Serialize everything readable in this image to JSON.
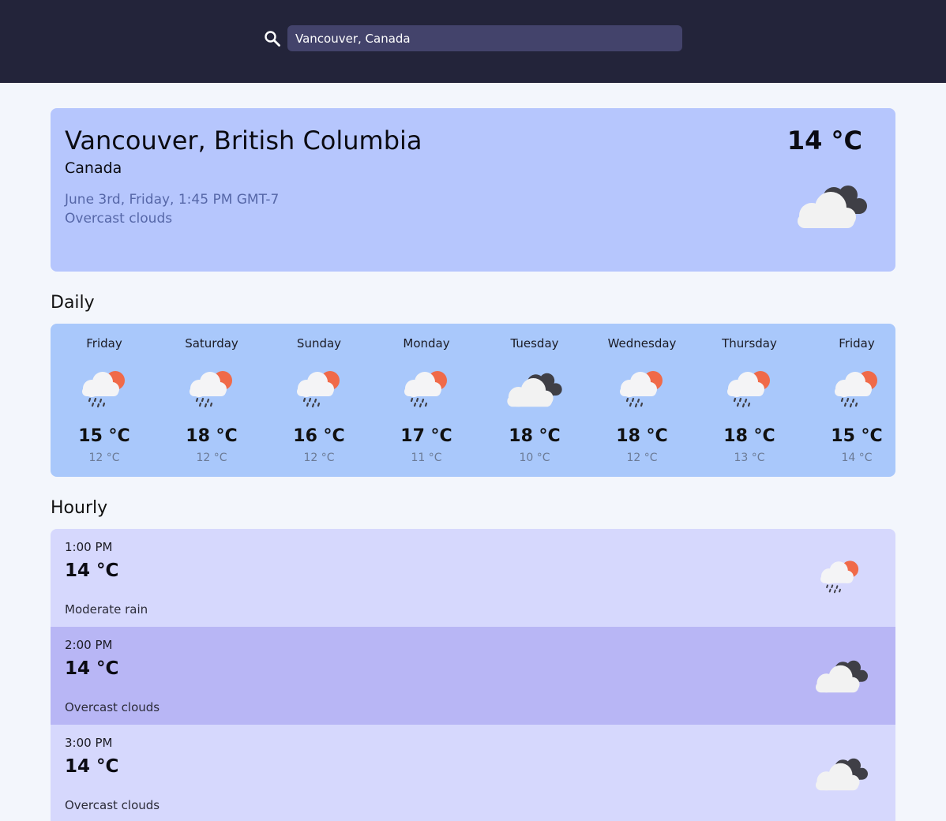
{
  "search": {
    "value": "Vancouver, Canada",
    "icon": "search-icon"
  },
  "current": {
    "city": "Vancouver, British Columbia",
    "country": "Canada",
    "datetime": "June 3rd, Friday, 1:45 PM GMT-7",
    "description": "Overcast clouds",
    "temperature": "14 °C",
    "icon": "overcast-clouds-icon"
  },
  "sections": {
    "daily_title": "Daily",
    "hourly_title": "Hourly"
  },
  "daily": [
    {
      "day": "Friday",
      "high": "15 °C",
      "low": "12 °C",
      "icon": "rain-sun-icon"
    },
    {
      "day": "Saturday",
      "high": "18 °C",
      "low": "12 °C",
      "icon": "rain-sun-icon"
    },
    {
      "day": "Sunday",
      "high": "16 °C",
      "low": "12 °C",
      "icon": "rain-sun-icon"
    },
    {
      "day": "Monday",
      "high": "17 °C",
      "low": "11 °C",
      "icon": "rain-sun-icon"
    },
    {
      "day": "Tuesday",
      "high": "18 °C",
      "low": "10 °C",
      "icon": "overcast-clouds-icon"
    },
    {
      "day": "Wednesday",
      "high": "18 °C",
      "low": "12 °C",
      "icon": "rain-sun-icon"
    },
    {
      "day": "Thursday",
      "high": "18 °C",
      "low": "13 °C",
      "icon": "rain-sun-icon"
    },
    {
      "day": "Friday",
      "high": "15 °C",
      "low": "14 °C",
      "icon": "rain-sun-icon"
    }
  ],
  "hourly": [
    {
      "time": "1:00 PM",
      "temp": "14 °C",
      "description": "Moderate rain",
      "icon": "rain-sun-icon"
    },
    {
      "time": "2:00 PM",
      "temp": "14 °C",
      "description": "Overcast clouds",
      "icon": "overcast-clouds-icon"
    },
    {
      "time": "3:00 PM",
      "temp": "14 °C",
      "description": "Overcast clouds",
      "icon": "overcast-clouds-icon"
    }
  ],
  "colors": {
    "header_bg": "#23243a",
    "search_bg": "#43436b",
    "current_card_bg": "#b6c6fd",
    "daily_card_bg": "#a9c8fb",
    "hourly_row_bg": "#d6d8fd",
    "hourly_row_alt_bg": "#b8b6f5",
    "sun": "#f06a49",
    "cloud_light": "#f2f2f2",
    "cloud_dark": "#3f3f46"
  }
}
